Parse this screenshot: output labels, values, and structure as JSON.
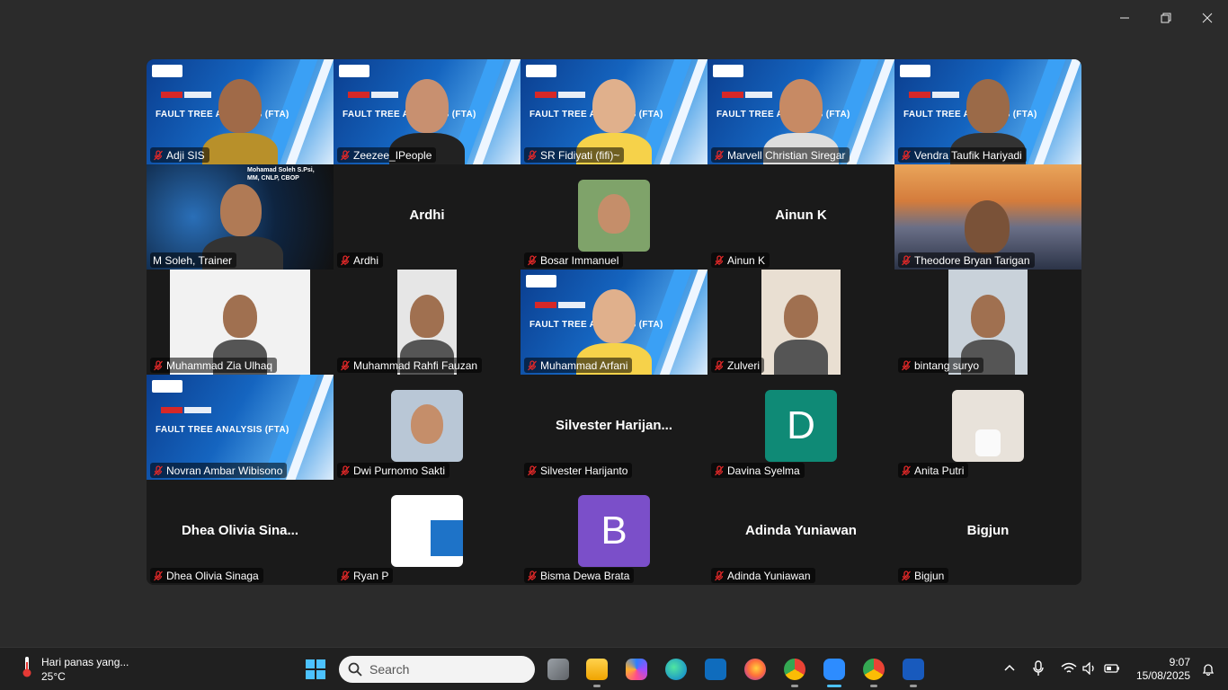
{
  "meeting": {
    "participants": [
      {
        "name": "Adji SIS",
        "kind": "banner-person"
      },
      {
        "name": "Zeezee_IPeople",
        "kind": "banner-person",
        "active": true
      },
      {
        "name": "SR Fidiyati (fifi)~",
        "kind": "banner-person"
      },
      {
        "name": "Marvell Christian Siregar",
        "kind": "banner-person"
      },
      {
        "name": "Vendra Taufik Hariyadi",
        "kind": "banner-person"
      },
      {
        "name": "M Soleh, Trainer",
        "kind": "video",
        "muted": false,
        "overlay": "Mohamad Soleh S.Psi, MM, CNLP, CBOP"
      },
      {
        "name": "Ardhi",
        "kind": "name-only",
        "display": "Ardhi"
      },
      {
        "name": "Bosar Immanuel",
        "kind": "photo"
      },
      {
        "name": "Ainun K",
        "kind": "name-only",
        "display": "Ainun K"
      },
      {
        "name": "Theodore Bryan Tarigan",
        "kind": "video"
      },
      {
        "name": "Muhammad Zia Ulhaq",
        "kind": "video-narrow"
      },
      {
        "name": "Muhammad Rahfi Fauzan",
        "kind": "video-narrow"
      },
      {
        "name": "Muhammad Arfani",
        "kind": "banner-person"
      },
      {
        "name": "Zulveri",
        "kind": "video-narrow"
      },
      {
        "name": "bintang suryo",
        "kind": "video-narrow"
      },
      {
        "name": "Novran Ambar Wibisono",
        "kind": "banner"
      },
      {
        "name": "Dwi Purnomo Sakti",
        "kind": "photo"
      },
      {
        "name": "Silvester Harijanto",
        "kind": "name-only",
        "display": "Silvester  Harijan..."
      },
      {
        "name": "Davina Syelma",
        "kind": "letter",
        "letter": "D",
        "color": "#0f8a76"
      },
      {
        "name": "Anita Putri",
        "kind": "photo-light"
      },
      {
        "name": "Dhea Olivia Sinaga",
        "kind": "name-only",
        "display": "Dhea  Olivia  Sina..."
      },
      {
        "name": "Ryan P",
        "kind": "photo-banner"
      },
      {
        "name": "Bisma Dewa Brata",
        "kind": "letter",
        "letter": "B",
        "color": "#7b4fc9"
      },
      {
        "name": "Adinda Yuniawan",
        "kind": "name-only",
        "display": "Adinda Yuniawan"
      },
      {
        "name": "Bigjun",
        "kind": "name-only",
        "display": "Bigjun"
      }
    ],
    "banner": {
      "short": "Short",
      "training": "Training",
      "title": "FAULT TREE ANALYSIS (FTA)"
    }
  },
  "taskbar": {
    "weather": {
      "line1": "Hari panas yang...",
      "temp": "25°C"
    },
    "search_placeholder": "Search",
    "apps": [
      "task-view",
      "file-explorer",
      "copilot",
      "edge",
      "outlook",
      "firefox",
      "chrome",
      "zoom",
      "chrome-profile",
      "word"
    ],
    "clock": {
      "time": "9:07",
      "date": "15/08/2025"
    }
  },
  "colors": {
    "active_speaker": "#23d959",
    "muted_icon": "#e02828",
    "accent": "#4cc2ff"
  }
}
